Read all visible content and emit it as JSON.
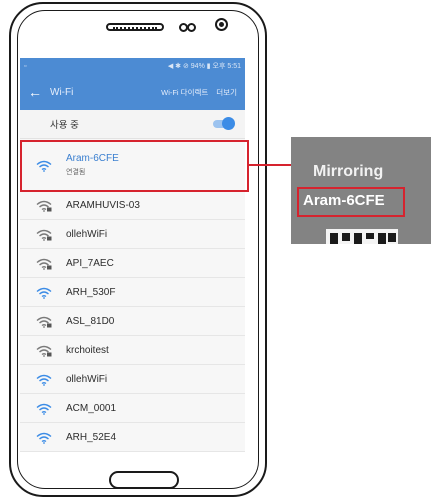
{
  "status_bar": {
    "left_icon": "notification-icon",
    "right_text": "◀ ✱ ⊘ 94% ▮ 오후 5:51"
  },
  "app_bar": {
    "title": "Wi-Fi",
    "action_direct": "Wi-Fi 다이렉트",
    "action_more": "더보기"
  },
  "wifi_toggle": {
    "label": "사용 중",
    "enabled": true
  },
  "networks": [
    {
      "name": "Aram-6CFE",
      "status": "연결됨",
      "secured": false,
      "connected": true
    },
    {
      "name": "ARAMHUVIS-03",
      "status": "",
      "secured": true,
      "connected": false
    },
    {
      "name": "ollehWiFi",
      "status": "",
      "secured": true,
      "connected": false
    },
    {
      "name": "API_7AEC",
      "status": "",
      "secured": true,
      "connected": false
    },
    {
      "name": "ARH_530F",
      "status": "",
      "secured": false,
      "connected": false
    },
    {
      "name": "ASL_81D0",
      "status": "",
      "secured": true,
      "connected": false
    },
    {
      "name": "krchoitest",
      "status": "",
      "secured": true,
      "connected": false
    },
    {
      "name": "ollehWiFi",
      "status": "",
      "secured": false,
      "connected": false
    },
    {
      "name": "ACM_0001",
      "status": "",
      "secured": false,
      "connected": false
    },
    {
      "name": "ARH_52E4",
      "status": "",
      "secured": false,
      "connected": false
    }
  ],
  "inset": {
    "title": "Mirroring",
    "network_name": "Aram-6CFE"
  },
  "colors": {
    "accent": "#4c8bd3",
    "highlight": "#d6232e",
    "wifi_icon": "#3c8ce6"
  }
}
